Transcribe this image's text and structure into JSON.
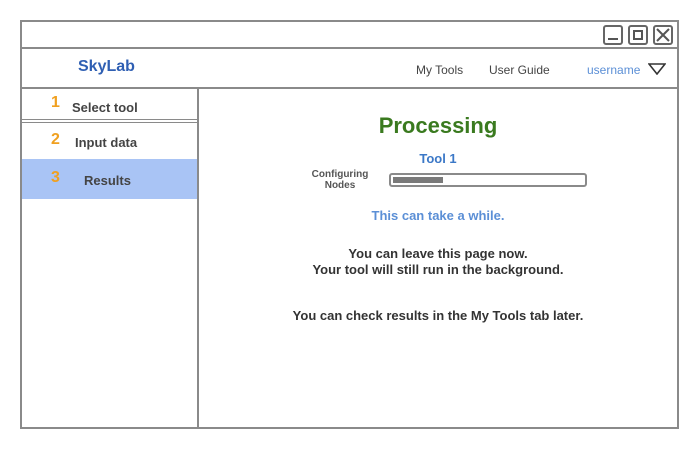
{
  "window": {
    "controls": [
      "minimize",
      "maximize",
      "close"
    ]
  },
  "header": {
    "brand": "SkyLab",
    "nav": {
      "my_tools": "My Tools",
      "user_guide": "User Guide"
    },
    "username": "username"
  },
  "sidebar": {
    "steps": [
      {
        "number": "1",
        "label": "Select  tool",
        "active": false
      },
      {
        "number": "2",
        "label": "Input data",
        "active": false
      },
      {
        "number": "3",
        "label": "Results",
        "active": true
      }
    ]
  },
  "main": {
    "heading": "Processing",
    "tool_name": "Tool 1",
    "progress": {
      "label_line1": "Configuring",
      "label_line2": "Nodes",
      "percent": 27
    },
    "note": "This can take a while.",
    "info_line1": "You can leave this page now.",
    "info_line2": "Your tool will still run in the background.",
    "info_line3": "You can check results in the My Tools tab later."
  },
  "colors": {
    "brand": "#2f5fb3",
    "heading": "#3a7a1f",
    "step_number": "#f0a020",
    "active_step_bg": "#a9c4f5",
    "link": "#5b8fd6"
  }
}
